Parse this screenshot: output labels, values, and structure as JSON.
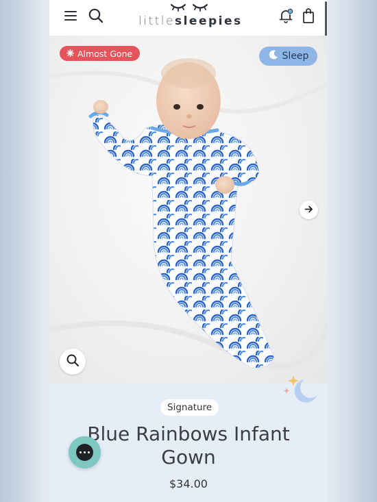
{
  "header": {
    "brand_part1": "little",
    "brand_part2": "sleepies",
    "icons": [
      "menu-icon",
      "search-icon",
      "notification-bell-icon",
      "shopping-bag-icon"
    ]
  },
  "hero": {
    "badge_left": "Almost Gone",
    "badge_left_color": "#e5545b",
    "badge_right": "Sleep",
    "badge_right_color": "#8fb5e6",
    "icons": [
      "sparkle-icon",
      "moon-icon",
      "arrow-right-icon",
      "magnifier-icon"
    ]
  },
  "product": {
    "tag": "Signature",
    "title_line1": "Blue Rainbows Infant",
    "title_line2": "Gown",
    "price": "$34.00",
    "print_color": "#2f6fce"
  },
  "chat": {
    "icon": "chat-bubble-icon",
    "color": "#7fc8c2"
  }
}
